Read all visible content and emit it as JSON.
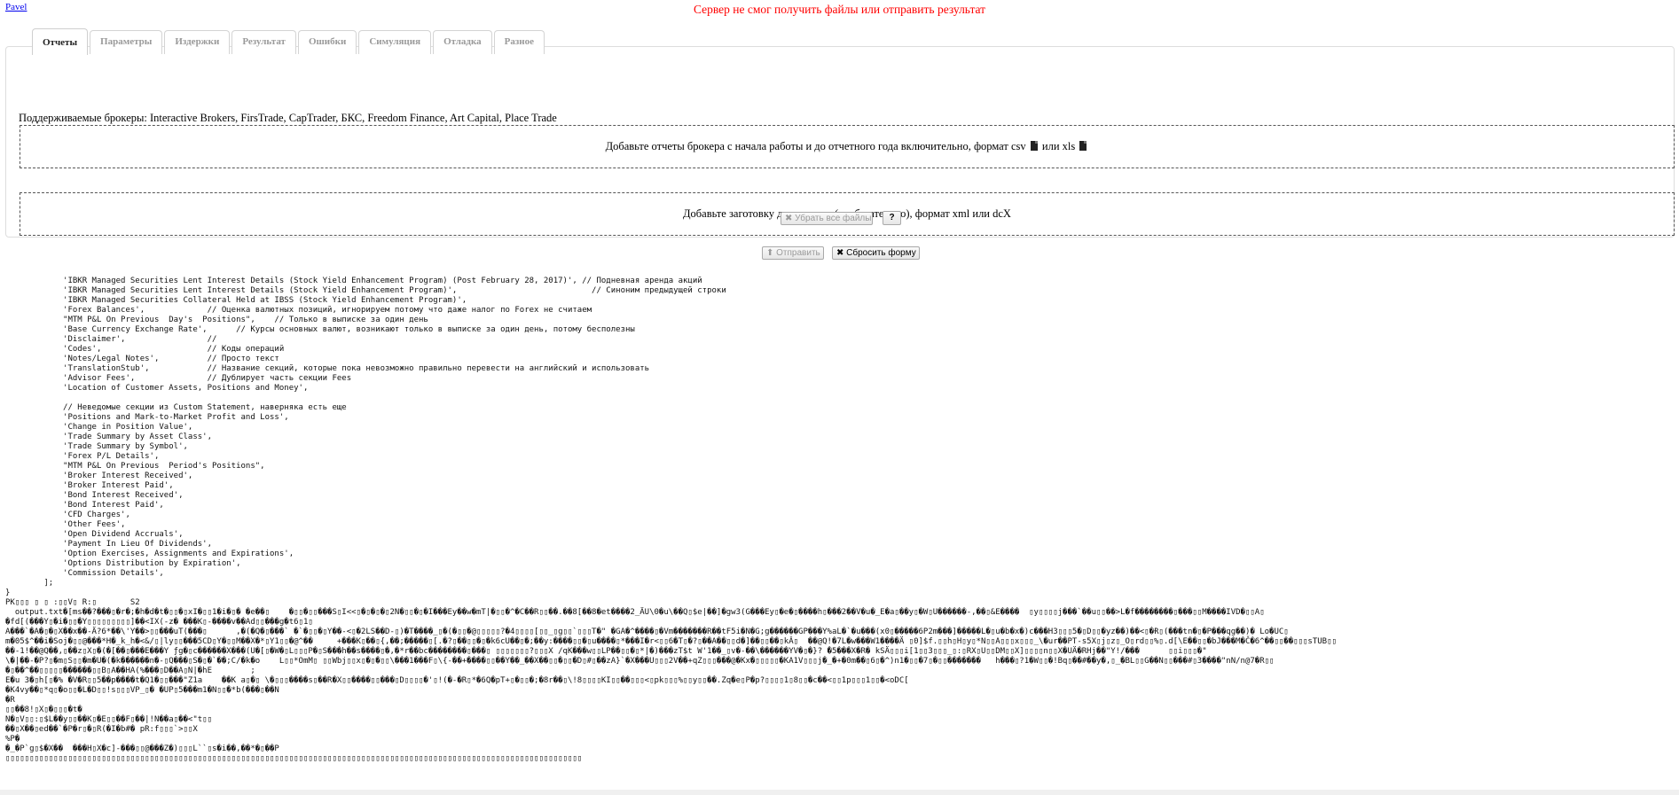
{
  "header": {
    "user": "Pavel",
    "error": "Сервер не смог получить файлы или отправить результат"
  },
  "tabs": [
    {
      "label": "Отчеты",
      "active": true
    },
    {
      "label": "Параметры",
      "active": false
    },
    {
      "label": "Издержки",
      "active": false
    },
    {
      "label": "Результат",
      "active": false
    },
    {
      "label": "Ошибки",
      "active": false
    },
    {
      "label": "Симуляция",
      "active": false
    },
    {
      "label": "Отладка",
      "active": false
    },
    {
      "label": "Разное",
      "active": false
    }
  ],
  "reports": {
    "brokers": "Поддерживаемые брокеры: Interactive Brokers, FirsTrade, CapTrader, БКС, Freedom Finance, Art Capital, Place Trade",
    "dropzone_reports_a": "Добавьте отчеты брокера с начала работы и до отчетного года включительно, формат csv",
    "dropzone_reports_b": "или xls",
    "dropzone_declaration": "Добавьте заготовку декларации (необязательно), формат xml или dcX",
    "clear_files_label": "✖ Убрать все файлы",
    "help_label": "?"
  },
  "form": {
    "send_label": "⬆ Отправить",
    "reset_label": "✖ Сбросить форму"
  },
  "colors": {
    "error": "#ff0000",
    "link": "#0000ee"
  },
  "debug_output": "            'IBKR Managed Securities Lent Interest Details (Stock Yield Enhancement Program) (Post February 28, 2017)', // Подневная аренда акций\n            'IBKR Managed Securities Lent Interest Details (Stock Yield Enhancement Program)',                            // Синоним предыдущей строки\n            'IBKR Managed Securities Collateral Held at IBSS (Stock Yield Enhancement Program)',\n            'Forex Balances',             // Оценка валютных позиций, игнорируем потому что даже налог по Forex не считаем\n            \"MTM P&L On Previous  Day's  Positions\",    // Только в выписке за один день\n            'Base Currency Exchange Rate',      // Курсы основных валют, возникают только в выписке за один день, потому бесполезны\n            'Disclaimer',                 //\n            'Codes',                      // Коды операций\n            'Notes/Legal Notes',          // Просто текст\n            'TranslationStub',            // Название секций, которые пока невозможно правильно перевести на английский и использовать\n            'Advisor Fees',               // Дублирует часть секции Fees\n            'Location of Customer Assets, Positions and Money',\n\n            // Неведомые секции из Custom Statement, наверняка есть еще\n            'Positions and Mark-to-Market Profit and Loss',\n            'Change in Position Value',\n            'Trade Summary by Asset Class',\n            'Trade Summary by Symbol',\n            'Forex P/L Details',\n            \"MTM P&L On Previous  Period's Positions\",\n            'Broker Interest Received',\n            'Broker Interest Paid',\n            'Bond Interest Received',\n            'Bond Interest Paid',\n            'CFD Charges',\n            'Other Fees',\n            'Open Dividend Accruals',\n            'Payment In Lieu Of Dividends',\n            'Option Exercises, Assignments and Expirations',\n            'Options Distribution by Expiration',\n            'Commission Details',\n        ];\n}\nPK▯▯▯ ▯ ▯ :▯▯V▯ R:▯       S2\n  output.txt�[ms��?���▯�r�;�h�d�t�▯▯�▯xI�▯▯1�i�▯� �e��▯    �▯▯�▯▯���S▯I<<▯�▯�▯�▯2N�▯▯�▯�I���Ey��w�mT|�▯▯�^�C��R▯▯��.��8[��8�et����2_ÄU\\0�u\\��Q▯$e|��]�gw3(G���Ey▯�e�▯����h▯���2��V�u�_E�a▯��y▯�W▯U������-,��▯&E����  ▯y▯▯▯▯j���`��u▯▯��>L�f��������▯���▯▯M����IVD�▯▯A▯\n�fd[(���Y▯�i�▯▯�Y▯▯▯▯▯▯▯▯▯]��<IX(-z� ���K▯-����v��Ad▯▯���g�t6▯1▯\nA���`�A�▯�▯X��x��-Ä?6*��\\'Y��>▯▯���uT(���▯      ,�(�Q�▯���` �`�▯▯�▯Y��-<▯�2LS��D-▯)�T����_▯�(�▯▯�@▯▯▯▯▯?�4▯▯▯▯[▯▯_▯g▯▯`▯▯▯T�\" �GA�^����▯�Vm�������R��tF5i�N�G;g������GP���Y%aL�`�u���(x0▯�����6P2m���]�����L�▯u�b�x�)c���H3▯▯▯5�▯D▯▯�yz��)��<▯�Ɍ▯(���tn�▯�P���qg��)� Lo�UC▯\nm�05$^��i�Soj�▯▯@���*H�_k_h�<&/▯|ly▯▯���5CD▯Y�▯▯M��X�*▯Y1▯▯�@^��     +���K▯��▯{,��;�����▯[.�?▯��▯▯�▯�k6cU��▯�;��y:����▯▯�▯u����▯*���I�r<▯▯6�T▯�?▯��A��▯▯d�]��▯▯��▯kÂ▯  ��@Q!�7L�w���W1����Ä ▯0]$f.▯▯h▯H▯y▯*N▯▯A▯▯▯x▯▯▯_\\�ur��PT-s5X▯j▯z▯_O▯rd▯▯%▯.d[\\E��▯▯�bJ���M�Č�6^��▯▯��▯▯▯sTUB▯▯\n��-1!��@Q��,▯��z▯X▯�(�[��▯���E���Y ƒg�▯c������X���(U�[▯�W�▯L▯▯▯P�▯S���h��s����▯�,�*r��bc��������▯���▯ ▯▯▯▯▯▯▯?▯▯▯X /qK���w▯▯LP��▯▯�▯*|�)���zT$t W'1��_▯v�-��\\������YV�▯�}? ̀�5���X�R� kSÄ▯▯▯i[1▯▯3▯▯▯_▯:▯RX▯U▯▯DM▯▯X]▯▯▯▯n▯▯X�UÄ�RHj��\"Y!/���      ▯▯i▯▯▯�\"\n\\�|��-�P?▯�m▯S▯▯�m�U�(�k������n�-▯Q���▯S�▯�`��;C/�k�o    L▯▯*OmM▯ ▯▯Wbj▯▯x▯�▯�▯▯\\���1���F▯\\{-��+����▯▯��Y��_��X��▯▯�▯▯�D▯#▯��zA}`�X���U▯▯▯2V��+qZ▯▯▯���@�Kx�▯▯▯▯▯�KA1V▯▯▯j�_�+�0m��▯6▯�^)n1�▯▯�7▯�▯▯�������   h���▯?1�W▯▯�!Bq▯��#��y�,▯_�BL▯▯G��N▯▯���#▯3����\"nN/n@7�R▯▯\n�▯��^��▯▯▯▯▯������▯▯B▯A��HA(%���▯D��A▯N|�hE        ;\nE�u 3�▯h[▯�% �V�R▯▯5��p����t�Q1�▯▯���\"Z1a    ��K a▯�▯ \\�▯▯▯����s▯��R�X▯▯����▯▯���▯D▯▯▯▯�'▯!(�-�R▯*�6Q�pT+▯�▯▯�;�8r��▯\\!8▯▯▯▯KI▯▯��▯▯▯<▯pk▯▯▯%▯▯y▯▯��.Zq�e▯P�p?▯▯▯▯1▯8▯▯�c��<▯▯1p▯▯▯1▯▯�<oDC[\n�K4vy��▯*q▯�o▯▯�L�D▯▯!s▯▯▯VP_▯� �UP▯5���m1�N▯▯�*b(���▯��N\n�R\n▯▯��8!▯X▯�▯▯▯�t�\nN�▯V▯▯:▯$L��y▯▯��K▯�E▯▯��F▯��|!N��a▯��<\"t▯▯\n��▯X��▯ed��`�P�r▯�▯R(�I�b#� pR:f▯▯▯`>▯▯X\n%P�\n�_�P`g▯$�X��  ���H▯X�c]-���▯▯@���Z�)▯▯▯L``▯s�i��,��*�▯��P\n▯▯▯▯▯▯▯▯▯▯▯▯▯▯▯▯▯▯▯▯▯▯▯▯▯▯▯▯▯▯▯▯▯▯▯▯▯▯▯▯▯▯▯▯▯▯▯▯▯▯▯▯▯▯▯▯▯▯▯▯▯▯▯▯▯▯▯▯▯▯▯▯▯▯▯▯▯▯▯▯▯▯▯▯▯▯▯▯▯▯▯▯▯▯▯▯▯▯▯▯▯▯▯▯▯▯▯▯▯▯▯▯▯▯▯▯▯▯▯▯"
}
